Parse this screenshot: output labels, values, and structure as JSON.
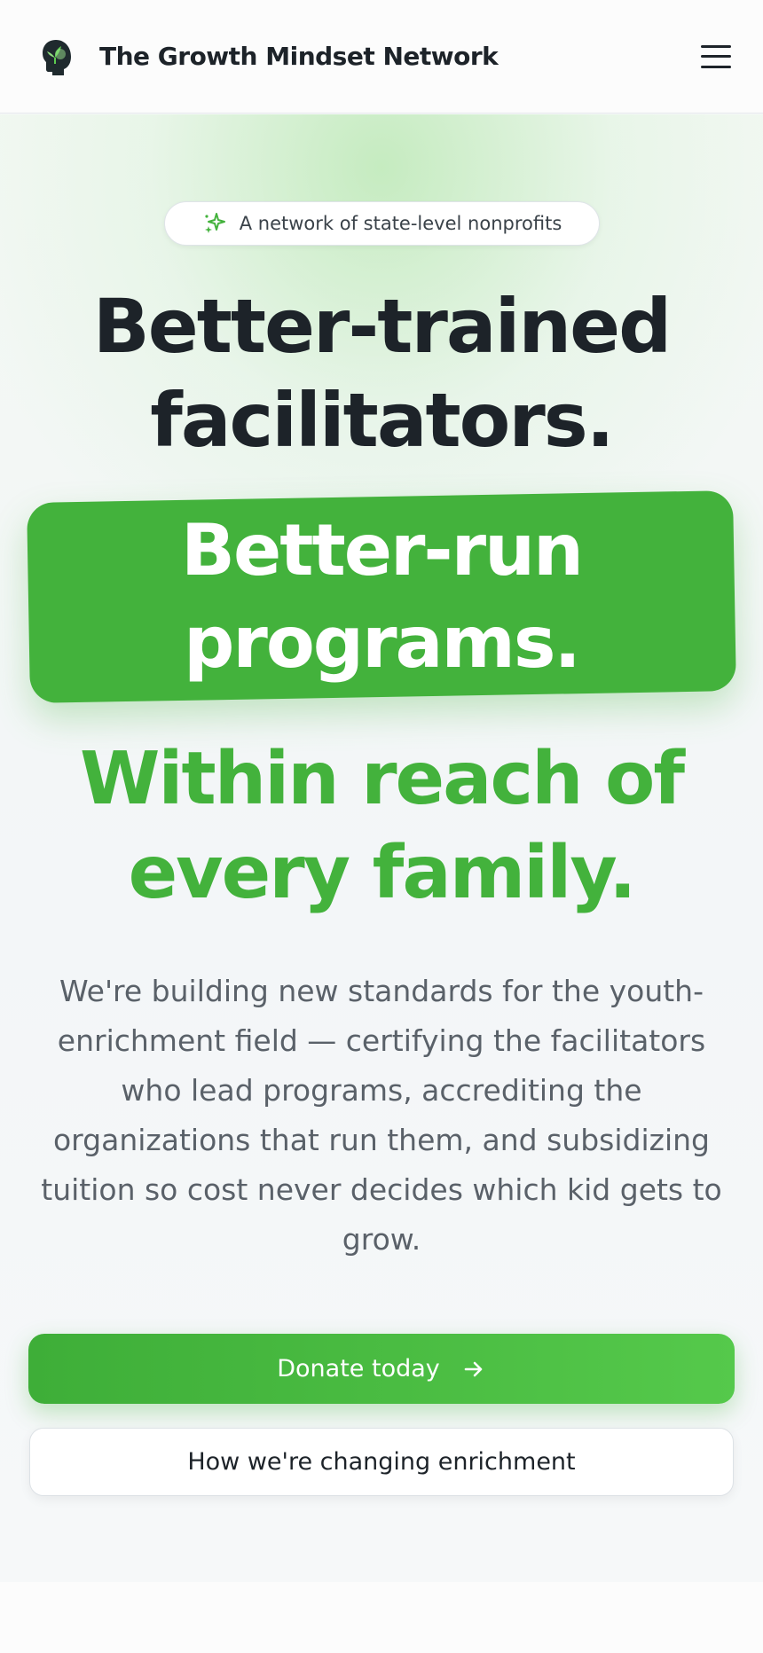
{
  "header": {
    "brand_name": "The Growth Mindset Network",
    "logo_icon": "head-sprout-logo-icon",
    "menu_icon": "hamburger-menu-icon"
  },
  "hero": {
    "badge_icon": "sparkle-icon",
    "badge_text": "A network of state-level nonprofits",
    "headline_line1": "Better-trained",
    "headline_line2": "facilitators.",
    "highlight_line1": "Better-run",
    "highlight_line2": "programs.",
    "green_line1": "Within reach of",
    "green_line2": "every family.",
    "lead": "We're building new standards for the youth-enrichment field — certifying the facilitators who lead programs, accrediting the organizations that run them, and subsidizing tuition so cost never decides which kid gets to grow.",
    "primary_cta": "Donate today",
    "primary_cta_icon": "arrow-right-icon",
    "secondary_cta": "How we're changing enrichment"
  },
  "colors": {
    "accent": "#43b23c",
    "text": "#1d2329",
    "muted": "#5a6169"
  }
}
